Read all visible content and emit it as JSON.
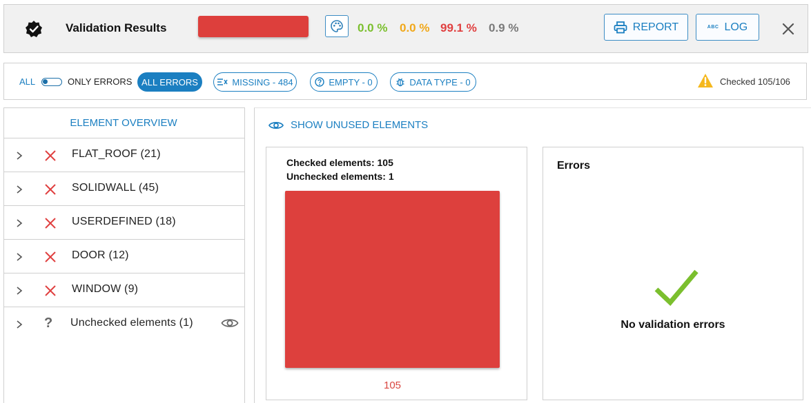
{
  "header": {
    "title": "Validation Results",
    "progress_fraction": 1.0,
    "progress_color": "#dd3f3c",
    "percentages": {
      "green": "0.0 %",
      "orange": "0.0 %",
      "red": "99.1 %",
      "gray": "0.9 %"
    },
    "colors": {
      "green": "#7bbf2e",
      "orange": "#f1a81a",
      "red": "#e04040",
      "gray": "#7a7a7a",
      "accent": "#1b7fc1"
    },
    "report_label": "REPORT",
    "log_label": "LOG",
    "log_icon_text": "ABC"
  },
  "filters": {
    "all_label": "ALL",
    "only_errors_label": "ONLY ERRORS",
    "chips": {
      "all_errors": "ALL ERRORS",
      "missing": "MISSING - 484",
      "empty": "EMPTY - 0",
      "data_type": "DATA TYPE - 0"
    },
    "checked_text": "Checked 105/106"
  },
  "element_overview": {
    "title": "ELEMENT OVERVIEW",
    "items": [
      {
        "label": "FLAT_ROOF (21)",
        "status": "error"
      },
      {
        "label": "SOLIDWALL (45)",
        "status": "error"
      },
      {
        "label": "USERDEFINED (18)",
        "status": "error"
      },
      {
        "label": "DOOR (12)",
        "status": "error"
      },
      {
        "label": "WINDOW (9)",
        "status": "error"
      },
      {
        "label": "Unchecked elements (1)",
        "status": "unknown",
        "status_glyph": "?"
      }
    ]
  },
  "main": {
    "show_unused_label": "SHOW UNUSED ELEMENTS",
    "chart_card": {
      "checked_line": "Checked elements: 105",
      "unchecked_line": "Unchecked elements: 1"
    },
    "errors_card": {
      "title": "Errors",
      "message": "No validation errors"
    }
  },
  "chart_data": {
    "type": "bar",
    "categories": [
      ""
    ],
    "values": [
      105
    ],
    "data_labels": [
      "105"
    ],
    "ylim": [
      0,
      105
    ],
    "bar_color": "#dd3f3c",
    "label_color": "#d9453f",
    "grid": false,
    "legend": "none"
  }
}
